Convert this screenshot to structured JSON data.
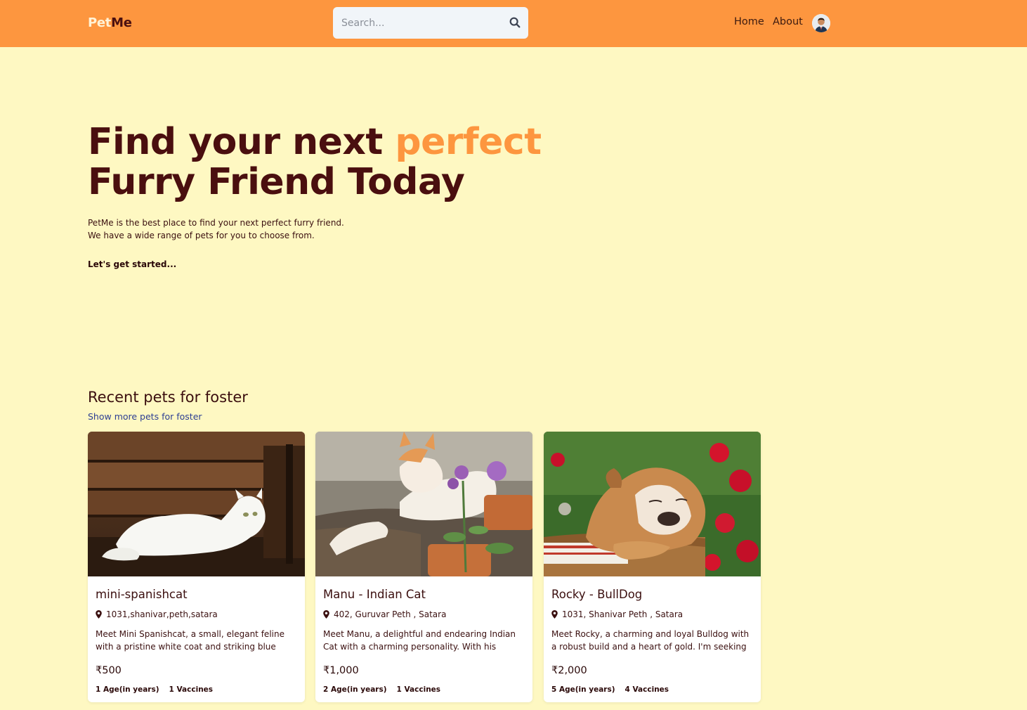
{
  "navbar": {
    "logo_part1": "Pet",
    "logo_part2": "Me",
    "search_placeholder": "Search...",
    "links": [
      "Home",
      "About"
    ]
  },
  "hero": {
    "title_line1_start": "Find your next ",
    "title_accent": "perfect",
    "title_line2": "Furry Friend Today",
    "desc_line1": "PetMe is the best place to find your next perfect furry friend.",
    "desc_line2": "We have a wide range of pets for you to choose from.",
    "cta": "Let's get started..."
  },
  "section": {
    "title": "Recent pets for foster",
    "link": "Show more pets for foster"
  },
  "pets": [
    {
      "name": "mini-spanishcat",
      "location": "1031,shanivar,peth,satara",
      "description": "Meet Mini Spanishcat, a small, elegant feline with a pristine white coat and striking blue eyes....",
      "price": "₹500",
      "age": "1 Age(in years)",
      "vaccines": "1 Vaccines"
    },
    {
      "name": "Manu - Indian Cat",
      "location": "402, Guruvar Peth , Satara",
      "description": "Meet Manu, a delightful and endearing Indian Cat with a charming personality. With his uniqu...",
      "price": "₹1,000",
      "age": "2 Age(in years)",
      "vaccines": "1 Vaccines"
    },
    {
      "name": "Rocky - BullDog",
      "location": "1031, Shanivar Peth , Satara",
      "description": "Meet Rocky, a charming and loyal Bulldog with a robust build and a heart of gold. I'm seeking a...",
      "price": "₹2,000",
      "age": "5 Age(in years)",
      "vaccines": "4 Vaccines"
    }
  ],
  "colors": {
    "navbar": "#fd963f",
    "background": "#fef8c2",
    "heading": "#4a0f0f",
    "accent": "#fd963f",
    "link": "#2c3e93"
  },
  "icons": {
    "search": "search-icon",
    "location": "map-pin-icon",
    "avatar": "user-avatar"
  }
}
